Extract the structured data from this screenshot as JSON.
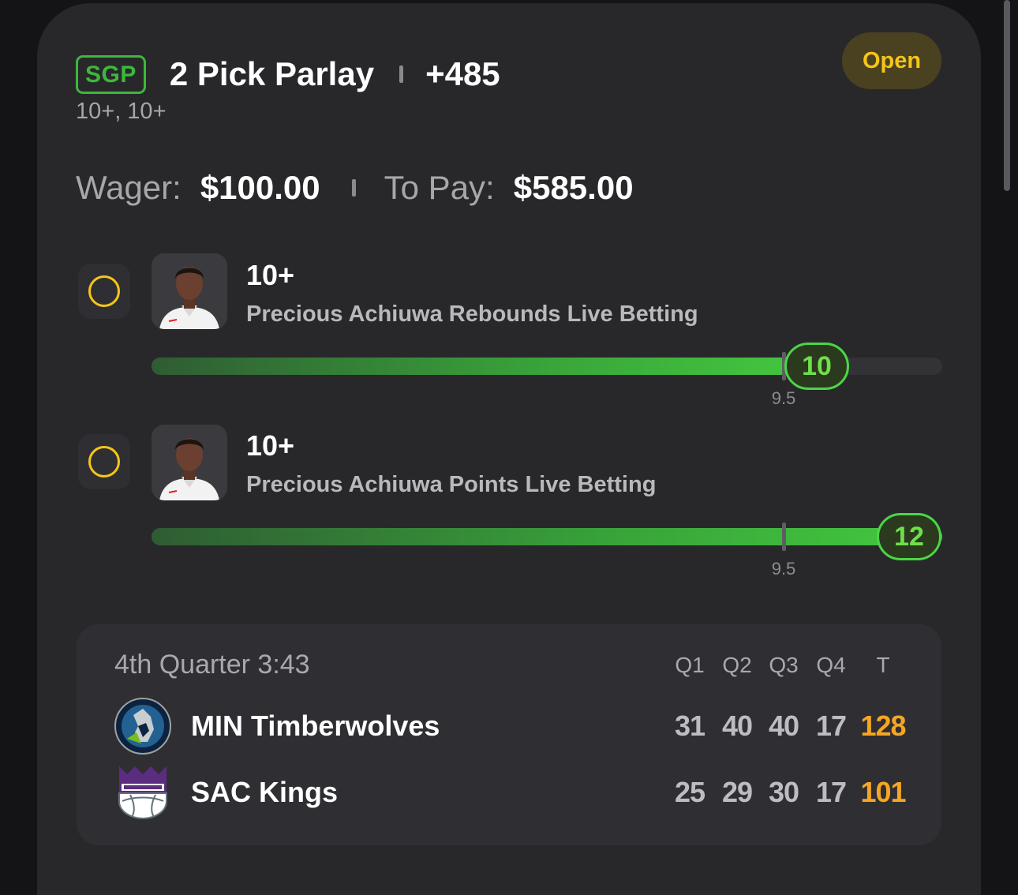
{
  "bet": {
    "badge": "SGP",
    "title": "2 Pick Parlay",
    "odds": "+485",
    "subtitle": "10+, 10+",
    "status": "Open",
    "wager_label": "Wager:",
    "wager_value": "$100.00",
    "payout_label": "To Pay:",
    "payout_value": "$585.00"
  },
  "legs": [
    {
      "line": "10+",
      "description": "Precious Achiuwa Rebounds Live Betting",
      "threshold_label": "9.5",
      "current_value": "10",
      "progress": 0.84
    },
    {
      "line": "10+",
      "description": "Precious Achiuwa Points Live Betting",
      "threshold_label": "9.5",
      "current_value": "12",
      "progress": 1.0
    }
  ],
  "scoreboard": {
    "clock": "4th Quarter 3:43",
    "quarters": [
      "Q1",
      "Q2",
      "Q3",
      "Q4",
      "T"
    ],
    "teams": [
      {
        "name": "MIN Timberwolves",
        "logo_icon": "timberwolves-logo-icon",
        "scores": [
          "31",
          "40",
          "40",
          "17",
          "128"
        ]
      },
      {
        "name": "SAC Kings",
        "logo_icon": "kings-logo-icon",
        "scores": [
          "25",
          "29",
          "30",
          "17",
          "101"
        ]
      }
    ]
  },
  "colors": {
    "accent_green": "#3cb83a",
    "status_yellow": "#f5c518",
    "total_orange": "#f5a623",
    "card_bg": "#28282b"
  }
}
